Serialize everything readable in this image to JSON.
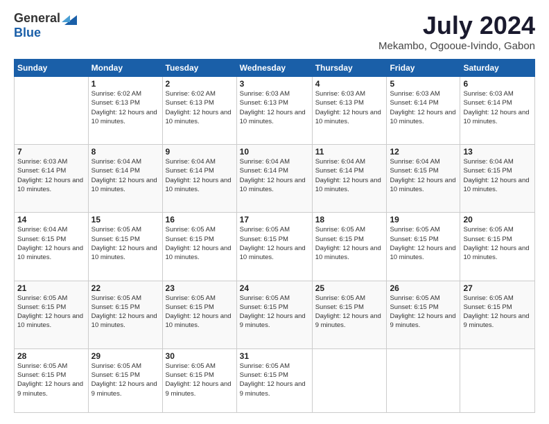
{
  "logo": {
    "general": "General",
    "blue": "Blue"
  },
  "title": {
    "month_year": "July 2024",
    "location": "Mekambo, Ogooue-Ivindo, Gabon"
  },
  "days_of_week": [
    "Sunday",
    "Monday",
    "Tuesday",
    "Wednesday",
    "Thursday",
    "Friday",
    "Saturday"
  ],
  "weeks": [
    [
      {
        "day": "",
        "info": ""
      },
      {
        "day": "1",
        "info": "Sunrise: 6:02 AM\nSunset: 6:13 PM\nDaylight: 12 hours and 10 minutes."
      },
      {
        "day": "2",
        "info": "Sunrise: 6:02 AM\nSunset: 6:13 PM\nDaylight: 12 hours and 10 minutes."
      },
      {
        "day": "3",
        "info": "Sunrise: 6:03 AM\nSunset: 6:13 PM\nDaylight: 12 hours and 10 minutes."
      },
      {
        "day": "4",
        "info": "Sunrise: 6:03 AM\nSunset: 6:13 PM\nDaylight: 12 hours and 10 minutes."
      },
      {
        "day": "5",
        "info": "Sunrise: 6:03 AM\nSunset: 6:14 PM\nDaylight: 12 hours and 10 minutes."
      },
      {
        "day": "6",
        "info": "Sunrise: 6:03 AM\nSunset: 6:14 PM\nDaylight: 12 hours and 10 minutes."
      }
    ],
    [
      {
        "day": "7",
        "info": "Sunrise: 6:03 AM\nSunset: 6:14 PM\nDaylight: 12 hours and 10 minutes."
      },
      {
        "day": "8",
        "info": "Sunrise: 6:04 AM\nSunset: 6:14 PM\nDaylight: 12 hours and 10 minutes."
      },
      {
        "day": "9",
        "info": "Sunrise: 6:04 AM\nSunset: 6:14 PM\nDaylight: 12 hours and 10 minutes."
      },
      {
        "day": "10",
        "info": "Sunrise: 6:04 AM\nSunset: 6:14 PM\nDaylight: 12 hours and 10 minutes."
      },
      {
        "day": "11",
        "info": "Sunrise: 6:04 AM\nSunset: 6:14 PM\nDaylight: 12 hours and 10 minutes."
      },
      {
        "day": "12",
        "info": "Sunrise: 6:04 AM\nSunset: 6:15 PM\nDaylight: 12 hours and 10 minutes."
      },
      {
        "day": "13",
        "info": "Sunrise: 6:04 AM\nSunset: 6:15 PM\nDaylight: 12 hours and 10 minutes."
      }
    ],
    [
      {
        "day": "14",
        "info": "Sunrise: 6:04 AM\nSunset: 6:15 PM\nDaylight: 12 hours and 10 minutes."
      },
      {
        "day": "15",
        "info": "Sunrise: 6:05 AM\nSunset: 6:15 PM\nDaylight: 12 hours and 10 minutes."
      },
      {
        "day": "16",
        "info": "Sunrise: 6:05 AM\nSunset: 6:15 PM\nDaylight: 12 hours and 10 minutes."
      },
      {
        "day": "17",
        "info": "Sunrise: 6:05 AM\nSunset: 6:15 PM\nDaylight: 12 hours and 10 minutes."
      },
      {
        "day": "18",
        "info": "Sunrise: 6:05 AM\nSunset: 6:15 PM\nDaylight: 12 hours and 10 minutes."
      },
      {
        "day": "19",
        "info": "Sunrise: 6:05 AM\nSunset: 6:15 PM\nDaylight: 12 hours and 10 minutes."
      },
      {
        "day": "20",
        "info": "Sunrise: 6:05 AM\nSunset: 6:15 PM\nDaylight: 12 hours and 10 minutes."
      }
    ],
    [
      {
        "day": "21",
        "info": "Sunrise: 6:05 AM\nSunset: 6:15 PM\nDaylight: 12 hours and 10 minutes."
      },
      {
        "day": "22",
        "info": "Sunrise: 6:05 AM\nSunset: 6:15 PM\nDaylight: 12 hours and 10 minutes."
      },
      {
        "day": "23",
        "info": "Sunrise: 6:05 AM\nSunset: 6:15 PM\nDaylight: 12 hours and 10 minutes."
      },
      {
        "day": "24",
        "info": "Sunrise: 6:05 AM\nSunset: 6:15 PM\nDaylight: 12 hours and 9 minutes."
      },
      {
        "day": "25",
        "info": "Sunrise: 6:05 AM\nSunset: 6:15 PM\nDaylight: 12 hours and 9 minutes."
      },
      {
        "day": "26",
        "info": "Sunrise: 6:05 AM\nSunset: 6:15 PM\nDaylight: 12 hours and 9 minutes."
      },
      {
        "day": "27",
        "info": "Sunrise: 6:05 AM\nSunset: 6:15 PM\nDaylight: 12 hours and 9 minutes."
      }
    ],
    [
      {
        "day": "28",
        "info": "Sunrise: 6:05 AM\nSunset: 6:15 PM\nDaylight: 12 hours and 9 minutes."
      },
      {
        "day": "29",
        "info": "Sunrise: 6:05 AM\nSunset: 6:15 PM\nDaylight: 12 hours and 9 minutes."
      },
      {
        "day": "30",
        "info": "Sunrise: 6:05 AM\nSunset: 6:15 PM\nDaylight: 12 hours and 9 minutes."
      },
      {
        "day": "31",
        "info": "Sunrise: 6:05 AM\nSunset: 6:15 PM\nDaylight: 12 hours and 9 minutes."
      },
      {
        "day": "",
        "info": ""
      },
      {
        "day": "",
        "info": ""
      },
      {
        "day": "",
        "info": ""
      }
    ]
  ]
}
